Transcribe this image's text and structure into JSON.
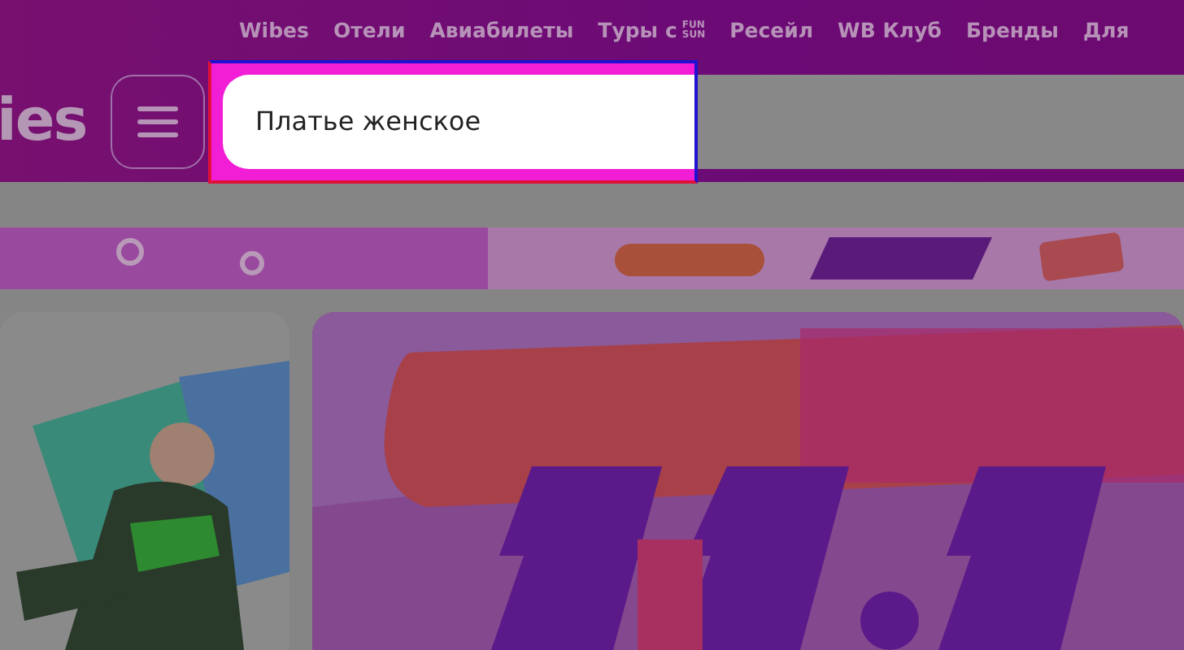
{
  "header": {
    "logo": "ies",
    "nav": [
      {
        "label": "Wibes"
      },
      {
        "label": "Отели"
      },
      {
        "label": "Авиабилеты"
      },
      {
        "label": "Туры с",
        "logo_lines": [
          "FUN",
          "SUN"
        ]
      },
      {
        "label": "Ресейл"
      },
      {
        "label": "WB Клуб"
      },
      {
        "label": "Бренды"
      },
      {
        "label": "Для"
      }
    ],
    "search": {
      "value": "Платье женское",
      "focused": true
    }
  }
}
